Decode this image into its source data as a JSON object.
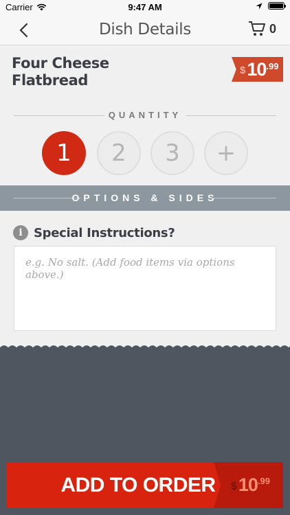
{
  "status_bar": {
    "carrier": "Carrier",
    "time": "9:47 AM"
  },
  "nav": {
    "title": "Dish Details",
    "cart_count": "0"
  },
  "dish": {
    "name_line1": "Four Cheese",
    "name_line2": "Flatbread",
    "price": {
      "currency": "$",
      "dollars": "10",
      "cents": ".99"
    }
  },
  "quantity": {
    "label": "QUANTITY",
    "options": [
      "1",
      "2",
      "3",
      "+"
    ],
    "selected": "1"
  },
  "options_bar": {
    "label": "OPTIONS & SIDES"
  },
  "instructions": {
    "title": "Special Instructions?",
    "placeholder": "e.g. No salt. (Add food items via options above.)",
    "value": ""
  },
  "add_to_order": {
    "label": "ADD TO ORDER",
    "price": {
      "currency": "$",
      "dollars": "10",
      "cents": ".99"
    }
  },
  "colors": {
    "accent_red": "#d12a14",
    "price_tag": "#cf4a2b",
    "options_bar": "#8c97a0",
    "dark_footer": "#4f5660"
  }
}
